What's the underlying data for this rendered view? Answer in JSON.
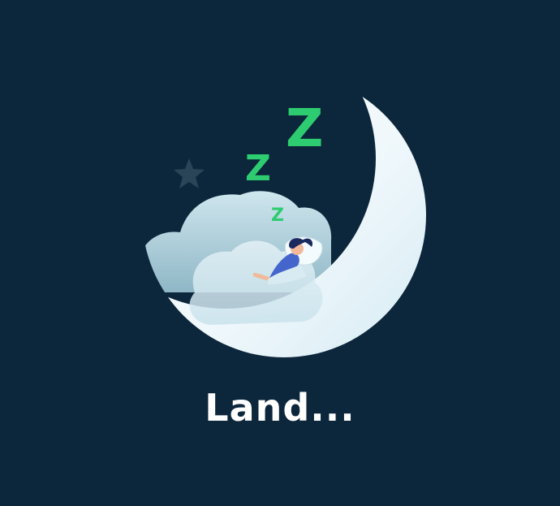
{
  "status": {
    "text": "Land..."
  },
  "illustration": {
    "z_letters": [
      "Z",
      "Z",
      "Z"
    ],
    "icons": [
      "moon-icon",
      "cloud-icon",
      "star-icon",
      "sleeping-person-icon",
      "pillow-icon"
    ]
  },
  "colors": {
    "background": "#0c263b",
    "moon": "#e8f4fa",
    "cloud": "#a8ccd8",
    "star": "#2a4557",
    "z_green": "#2ecc71",
    "person_blue": "#4466cc",
    "text": "#ffffff"
  }
}
